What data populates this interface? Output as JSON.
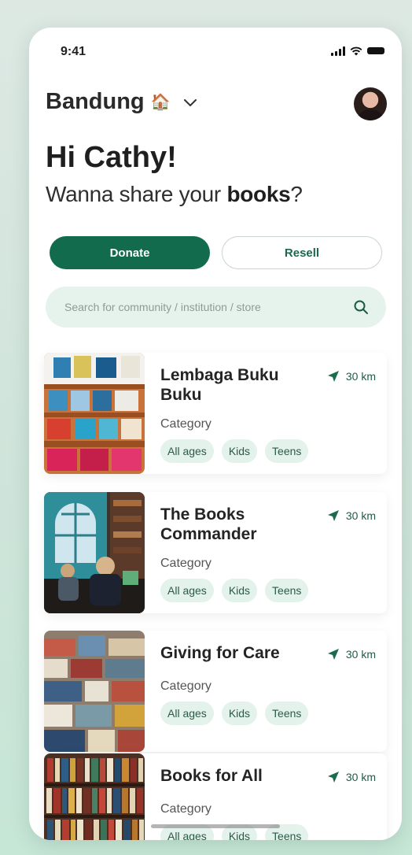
{
  "status_bar": {
    "time": "9:41"
  },
  "header": {
    "location": "Bandung",
    "location_emoji": "🏠"
  },
  "greeting": "Hi Cathy!",
  "subtitle": {
    "prefix": "Wanna share your ",
    "bold": "books",
    "suffix": "?"
  },
  "actions": {
    "donate_label": "Donate",
    "resell_label": "Resell"
  },
  "search": {
    "placeholder": "Search for community / institution / store"
  },
  "places": [
    {
      "title": "Lembaga Buku Buku",
      "distance": "30 km",
      "category_label": "Category",
      "tags": [
        "All ages",
        "Kids",
        "Teens"
      ]
    },
    {
      "title": "The Books Commander",
      "distance": "30 km",
      "category_label": "Category",
      "tags": [
        "All ages",
        "Kids",
        "Teens"
      ]
    },
    {
      "title": "Giving for Care",
      "distance": "30 km",
      "category_label": "Category",
      "tags": [
        "All ages",
        "Kids",
        "Teens"
      ]
    },
    {
      "title": "Books for All",
      "distance": "30 km",
      "category_label": "Category",
      "tags": [
        "All ages",
        "Kids",
        "Teens"
      ]
    }
  ],
  "colors": {
    "primary": "#136b4d",
    "chip_bg": "#e3f2ea",
    "search_bg": "#e6f3ec"
  }
}
